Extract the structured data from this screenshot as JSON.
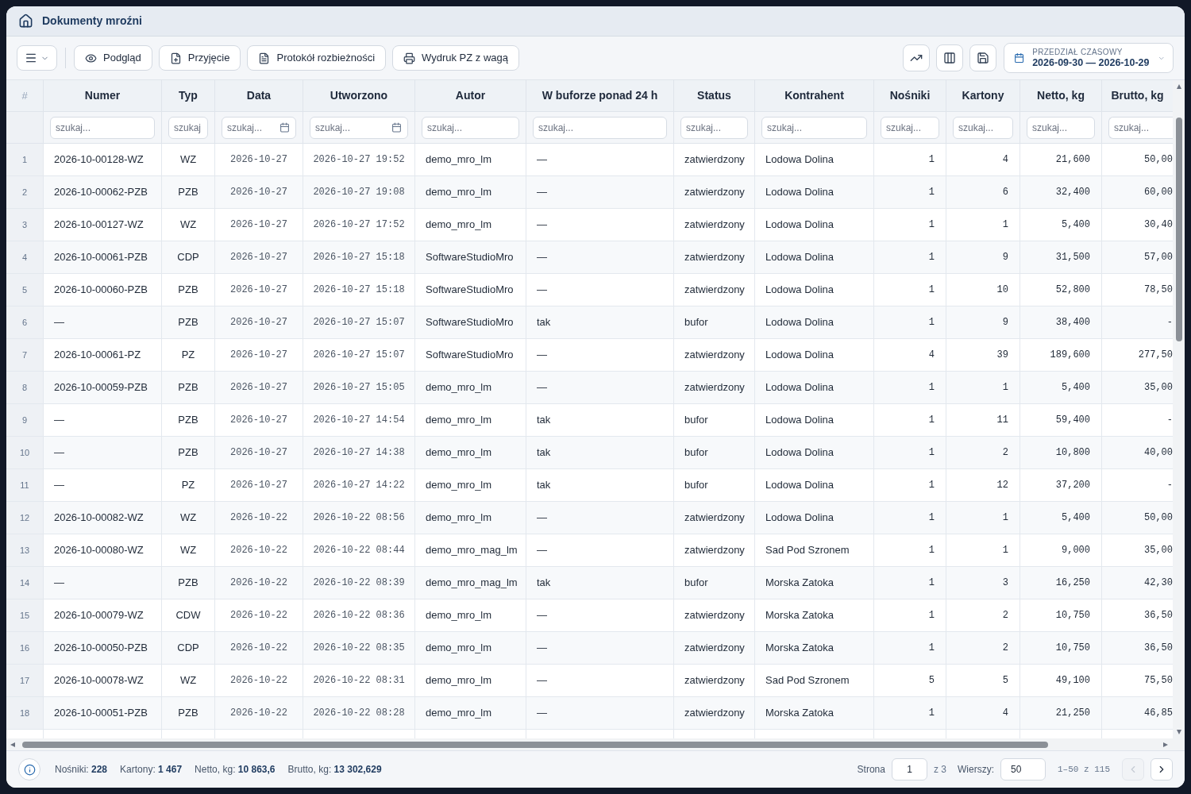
{
  "window": {
    "title": "Dokumenty mroźni"
  },
  "toolbar": {
    "actions": [
      {
        "label": "Podgląd"
      },
      {
        "label": "Przyjęcie"
      },
      {
        "label": "Protokół rozbieżności"
      },
      {
        "label": "Wydruk PZ z wagą"
      }
    ],
    "date_range": {
      "label": "PRZEDZIAŁ CZASOWY",
      "value": "2026-09-30 — 2026-10-29"
    }
  },
  "table": {
    "columns": [
      {
        "label": "#",
        "kind": "index"
      },
      {
        "label": "Numer",
        "kind": "text",
        "placeholder": "szukaj..."
      },
      {
        "label": "Typ",
        "kind": "code",
        "placeholder": "szukaj"
      },
      {
        "label": "Data",
        "kind": "date",
        "placeholder": "szukaj..."
      },
      {
        "label": "Utworzono",
        "kind": "datetime",
        "placeholder": "szukaj..."
      },
      {
        "label": "Autor",
        "kind": "text",
        "placeholder": "szukaj..."
      },
      {
        "label": "W buforze ponad 24 h",
        "kind": "text",
        "placeholder": "szukaj..."
      },
      {
        "label": "Status",
        "kind": "text",
        "placeholder": "szukaj..."
      },
      {
        "label": "Kontrahent",
        "kind": "text",
        "placeholder": "szukaj..."
      },
      {
        "label": "Nośniki",
        "kind": "number",
        "placeholder": "szukaj..."
      },
      {
        "label": "Kartony",
        "kind": "number",
        "placeholder": "szukaj..."
      },
      {
        "label": "Netto, kg",
        "kind": "number",
        "placeholder": "szukaj..."
      },
      {
        "label": "Brutto, kg",
        "kind": "number",
        "placeholder": "szukaj..."
      }
    ],
    "rows": [
      [
        "1",
        "2026-10-00128-WZ",
        "WZ",
        "2026-10-27",
        "2026-10-27 19:52",
        "demo_mro_lm",
        "—",
        "zatwierdzony",
        "Lodowa Dolina",
        "1",
        "4",
        "21,600",
        "50,00"
      ],
      [
        "2",
        "2026-10-00062-PZB",
        "PZB",
        "2026-10-27",
        "2026-10-27 19:08",
        "demo_mro_lm",
        "—",
        "zatwierdzony",
        "Lodowa Dolina",
        "1",
        "6",
        "32,400",
        "60,00"
      ],
      [
        "3",
        "2026-10-00127-WZ",
        "WZ",
        "2026-10-27",
        "2026-10-27 17:52",
        "demo_mro_lm",
        "—",
        "zatwierdzony",
        "Lodowa Dolina",
        "1",
        "1",
        "5,400",
        "30,40"
      ],
      [
        "4",
        "2026-10-00061-PZB",
        "CDP",
        "2026-10-27",
        "2026-10-27 15:18",
        "SoftwareStudioMro",
        "—",
        "zatwierdzony",
        "Lodowa Dolina",
        "1",
        "9",
        "31,500",
        "57,00"
      ],
      [
        "5",
        "2026-10-00060-PZB",
        "PZB",
        "2026-10-27",
        "2026-10-27 15:18",
        "SoftwareStudioMro",
        "—",
        "zatwierdzony",
        "Lodowa Dolina",
        "1",
        "10",
        "52,800",
        "78,50"
      ],
      [
        "6",
        "—",
        "PZB",
        "2026-10-27",
        "2026-10-27 15:07",
        "SoftwareStudioMro",
        "tak",
        "bufor",
        "Lodowa Dolina",
        "1",
        "9",
        "38,400",
        "-"
      ],
      [
        "7",
        "2026-10-00061-PZ",
        "PZ",
        "2026-10-27",
        "2026-10-27 15:07",
        "SoftwareStudioMro",
        "—",
        "zatwierdzony",
        "Lodowa Dolina",
        "4",
        "39",
        "189,600",
        "277,50"
      ],
      [
        "8",
        "2026-10-00059-PZB",
        "PZB",
        "2026-10-27",
        "2026-10-27 15:05",
        "demo_mro_lm",
        "—",
        "zatwierdzony",
        "Lodowa Dolina",
        "1",
        "1",
        "5,400",
        "35,00"
      ],
      [
        "9",
        "—",
        "PZB",
        "2026-10-27",
        "2026-10-27 14:54",
        "demo_mro_lm",
        "tak",
        "bufor",
        "Lodowa Dolina",
        "1",
        "11",
        "59,400",
        "-"
      ],
      [
        "10",
        "—",
        "PZB",
        "2026-10-27",
        "2026-10-27 14:38",
        "demo_mro_lm",
        "tak",
        "bufor",
        "Lodowa Dolina",
        "1",
        "2",
        "10,800",
        "40,00"
      ],
      [
        "11",
        "—",
        "PZ",
        "2026-10-27",
        "2026-10-27 14:22",
        "demo_mro_lm",
        "tak",
        "bufor",
        "Lodowa Dolina",
        "1",
        "12",
        "37,200",
        "-"
      ],
      [
        "12",
        "2026-10-00082-WZ",
        "WZ",
        "2026-10-22",
        "2026-10-22 08:56",
        "demo_mro_lm",
        "—",
        "zatwierdzony",
        "Lodowa Dolina",
        "1",
        "1",
        "5,400",
        "50,00"
      ],
      [
        "13",
        "2026-10-00080-WZ",
        "WZ",
        "2026-10-22",
        "2026-10-22 08:44",
        "demo_mro_mag_lm",
        "—",
        "zatwierdzony",
        "Sad Pod Szronem",
        "1",
        "1",
        "9,000",
        "35,00"
      ],
      [
        "14",
        "—",
        "PZB",
        "2026-10-22",
        "2026-10-22 08:39",
        "demo_mro_mag_lm",
        "tak",
        "bufor",
        "Morska Zatoka",
        "1",
        "3",
        "16,250",
        "42,30"
      ],
      [
        "15",
        "2026-10-00079-WZ",
        "CDW",
        "2026-10-22",
        "2026-10-22 08:36",
        "demo_mro_lm",
        "—",
        "zatwierdzony",
        "Morska Zatoka",
        "1",
        "2",
        "10,750",
        "36,50"
      ],
      [
        "16",
        "2026-10-00050-PZB",
        "CDP",
        "2026-10-22",
        "2026-10-22 08:35",
        "demo_mro_lm",
        "—",
        "zatwierdzony",
        "Morska Zatoka",
        "1",
        "2",
        "10,750",
        "36,50"
      ],
      [
        "17",
        "2026-10-00078-WZ",
        "WZ",
        "2026-10-22",
        "2026-10-22 08:31",
        "demo_mro_lm",
        "—",
        "zatwierdzony",
        "Sad Pod Szronem",
        "5",
        "5",
        "49,100",
        "75,50"
      ],
      [
        "18",
        "2026-10-00051-PZB",
        "PZB",
        "2026-10-22",
        "2026-10-22 08:28",
        "demo_mro_lm",
        "—",
        "zatwierdzony",
        "Morska Zatoka",
        "1",
        "4",
        "21,250",
        "46,85"
      ]
    ]
  },
  "status_bar": {
    "summary": [
      "Nośniki: **228**",
      "Kartony: **1 467**",
      "Netto, kg: **10 863,6**",
      "Brutto, kg: **13 302,629**"
    ],
    "pagination": {
      "page_label": "Strona",
      "page": "1",
      "page_total": "z 3",
      "rows_label": "Wierszy:",
      "rows_per_page": "50",
      "range": "1–50 z 115",
      "prev": {
        "disabled": true
      },
      "next": {
        "disabled": false
      }
    }
  }
}
